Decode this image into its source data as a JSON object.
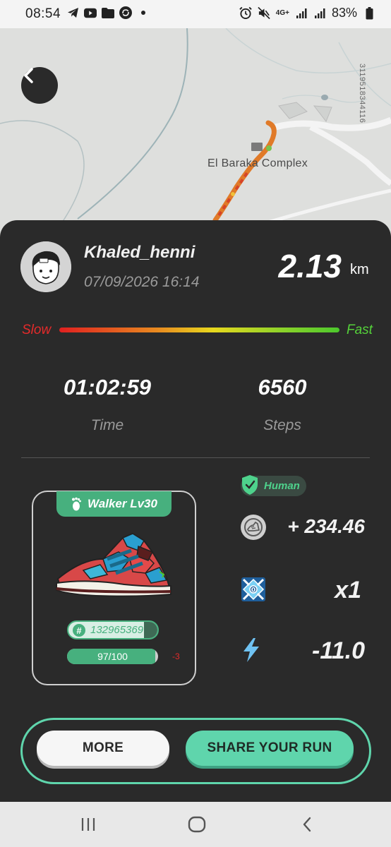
{
  "status_bar": {
    "time": "08:54",
    "network": "4G+",
    "battery": "83%"
  },
  "map": {
    "place_label": "El Baraka Complex",
    "vertical_code": "3119518344116"
  },
  "run": {
    "username": "Khaled_henni",
    "datetime": "07/09/2026 16:14",
    "distance": "2.13",
    "distance_unit": "km",
    "speed_scale": {
      "slow_label": "Slow",
      "fast_label": "Fast"
    },
    "time_value": "01:02:59",
    "time_label": "Time",
    "steps_value": "6560",
    "steps_label": "Steps"
  },
  "sneaker": {
    "tag_label": "Walker Lv30",
    "id": "132965369",
    "durability_text": "97/100",
    "durability_fraction": 0.97,
    "durability_delta": "-3"
  },
  "results": {
    "human_label": "Human",
    "reward": "+ 234.46",
    "multiplier": "x1",
    "energy": "-11.0"
  },
  "buttons": {
    "more": "MORE",
    "share": "SHARE YOUR RUN"
  },
  "colors": {
    "accent": "#5fd5ac",
    "tag_green": "#47b07e",
    "slow": "#e62a2a",
    "fast": "#55d23a",
    "panel": "#2a2a2a"
  },
  "icons": {
    "back": "chevron-left-icon",
    "reward": "sneaker-coin-icon",
    "multiplier": "gem-multiplier-icon",
    "energy": "lightning-icon",
    "human": "shield-check-icon",
    "walker": "footprint-icon"
  }
}
